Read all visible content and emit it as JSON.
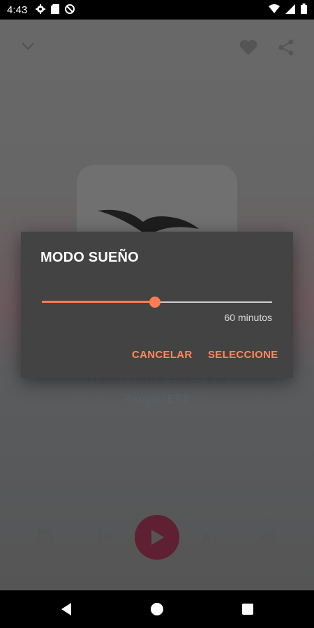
{
  "status_bar": {
    "time": "4:43",
    "left_icons": [
      "gear-icon",
      "sim-card-icon",
      "no-data-icon"
    ],
    "right_icons": [
      "wifi-icon",
      "signal-icon",
      "battery-icon"
    ]
  },
  "player": {
    "station_name": "Radio Libre 101.5 FM",
    "station_location": "Paraná (ERI)",
    "accent_color": "#5e2032",
    "top_icons": [
      "chevron-down-icon",
      "heart-icon",
      "share-icon"
    ],
    "control_icons": [
      "alarm-icon",
      "skip-previous-icon",
      "play-icon",
      "skip-next-icon",
      "volume-icon"
    ]
  },
  "dialog": {
    "title": "MODO SUEÑO",
    "slider_fraction": 0.49,
    "slider_value_label": "60 minutos",
    "cancel_label": "CANCELAR",
    "confirm_label": "SELECCIONE",
    "accent_color": "#ff7b52"
  },
  "nav_bar": {
    "icons": [
      "back-icon",
      "home-icon",
      "recents-icon"
    ]
  }
}
